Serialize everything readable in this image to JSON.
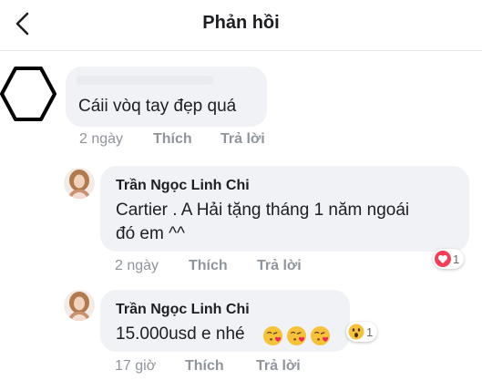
{
  "header": {
    "title": "Phản hồi"
  },
  "comments": [
    {
      "text": "Cáii vòq tay đẹp quá",
      "time": "2 ngày",
      "like_label": "Thích",
      "reply_label": "Trả lời"
    },
    {
      "author": "Trần Ngọc Linh Chi",
      "text_line1": "Cartier . A Hải tặng tháng 1 năm ngoái",
      "text_line2": "đó em ^^",
      "time": "2 ngày",
      "like_label": "Thích",
      "reply_label": "Trả lời",
      "reaction": {
        "icon": "heart-icon",
        "count": "1",
        "color": "#f33e58"
      }
    },
    {
      "author": "Trần Ngọc Linh Chi",
      "text": "15.000usd e nhé",
      "emojis": [
        "kissing-heart-icon",
        "kissing-heart-icon",
        "kissing-heart-icon"
      ],
      "time": "17 giờ",
      "like_label": "Thích",
      "reply_label": "Trả lời",
      "reaction": {
        "icon": "wow-icon",
        "count": "1"
      }
    }
  ]
}
